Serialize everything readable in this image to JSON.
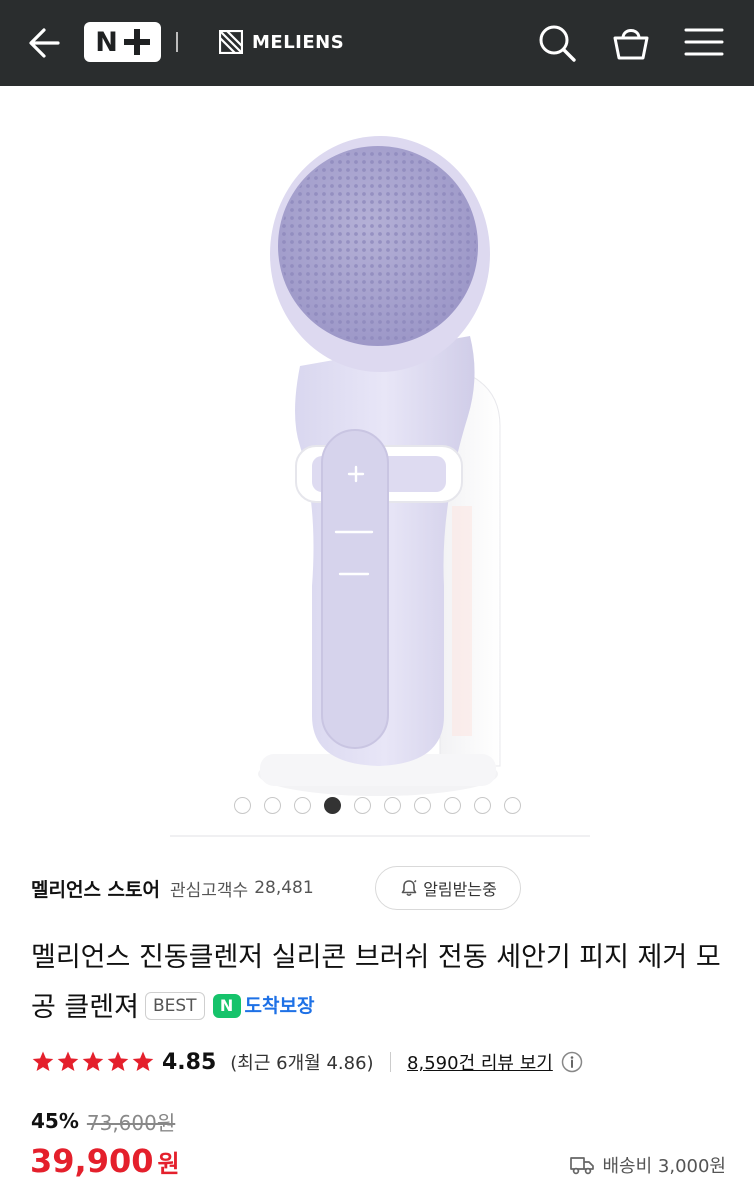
{
  "header": {
    "back_icon": "arrow-left-icon",
    "naverplus_logo": "N+",
    "brand_name": "MELIENS",
    "search_icon": "search-icon",
    "cart_icon": "shopping-bag-icon",
    "menu_icon": "hamburger-menu-icon",
    "bg_color": "#2a2d2e"
  },
  "gallery": {
    "image_description": "purple silicone face cleansing brush on white stand",
    "total_dots": 10,
    "active_index": 3
  },
  "store": {
    "name": "멜리언스 스토어",
    "fans_label": "관심고객수",
    "fans_count": "28,481",
    "alarm_button": "알림받는중"
  },
  "product": {
    "title": "멜리언스 진동클렌저 실리콘 브러쉬 전동 세안기 피지 제거 모공 클렌져",
    "badge": "BEST",
    "arrival_badge_n": "N",
    "arrival_text": "도착보장"
  },
  "rating": {
    "stars": 5,
    "score": "4.85",
    "recent": "(최근 6개월 4.86)",
    "reviews_link": "8,590건 리뷰 보기",
    "star_color": "#e4202c"
  },
  "price": {
    "discount": "45%",
    "original": "73,600원",
    "sale": "39,900",
    "currency": "원",
    "sale_color": "#e4202c",
    "shipping": "배송비 3,000원"
  }
}
